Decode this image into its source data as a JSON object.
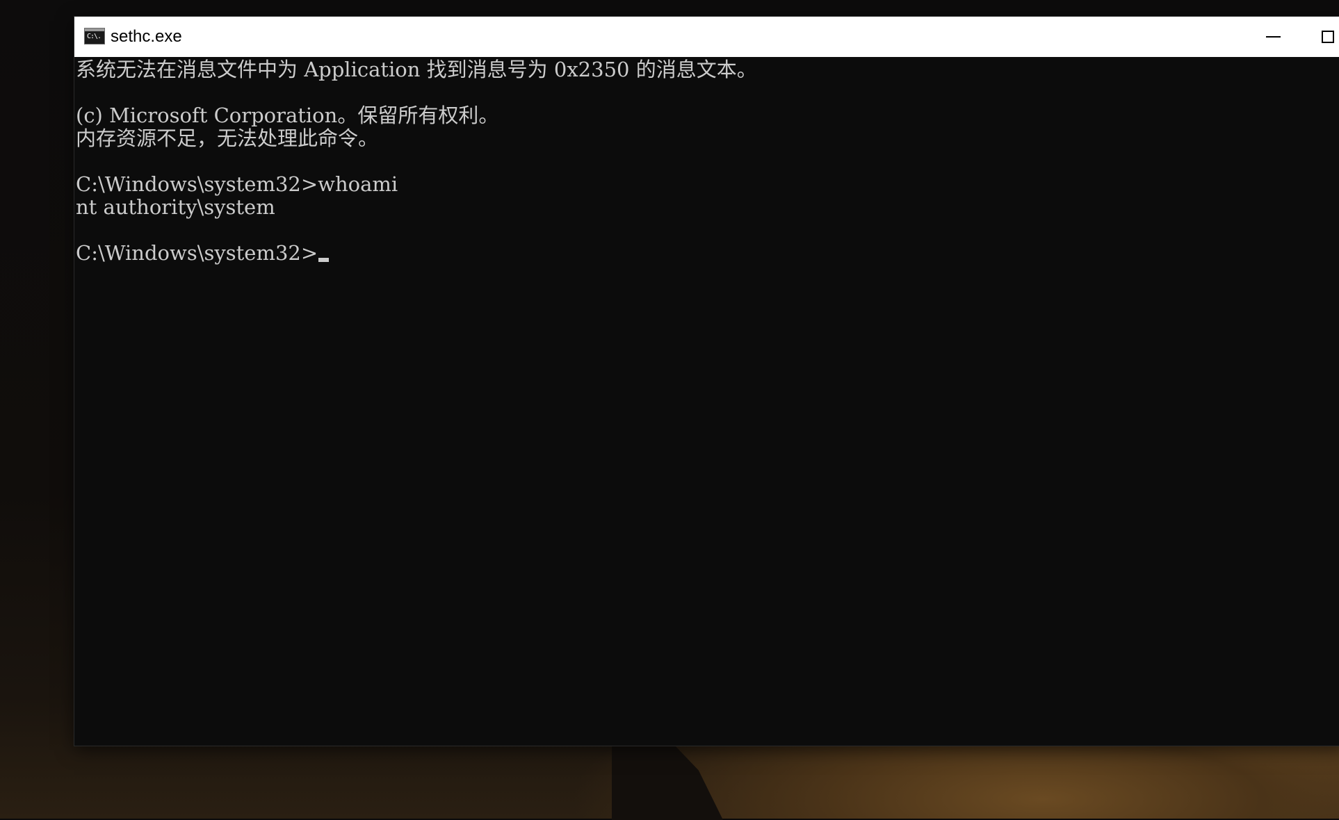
{
  "window": {
    "title": "sethc.exe",
    "icon": "console-app-icon",
    "icon_text": "C:\\."
  },
  "controls": {
    "minimize": "minimize-icon",
    "maximize": "maximize-icon"
  },
  "console": {
    "lines": [
      "系统无法在消息文件中为 Application 找到消息号为 0x2350 的消息文本。",
      "",
      "(c) Microsoft Corporation。保留所有权利。",
      "内存资源不足，无法处理此命令。",
      "",
      "C:\\Windows\\system32>whoami",
      "nt authority\\system",
      "",
      "C:\\Windows\\system32>"
    ]
  },
  "colors": {
    "console_bg": "#0c0c0c",
    "console_text": "#cccccc",
    "titlebar_bg": "#ffffff"
  }
}
